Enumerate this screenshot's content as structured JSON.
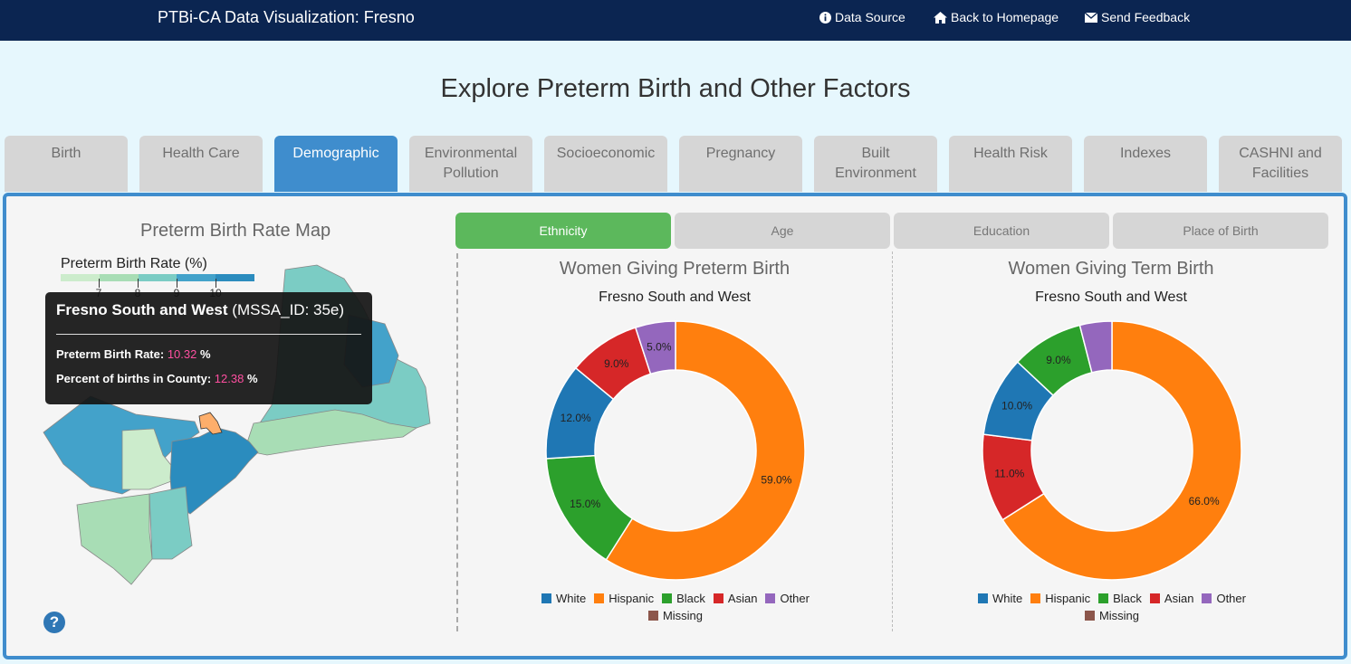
{
  "header": {
    "title": "PTBi-CA Data Visualization: Fresno",
    "links": [
      "Data Source",
      "Back to Homepage",
      "Send Feedback"
    ]
  },
  "page_title": "Explore Preterm Birth and Other Factors",
  "tabs": [
    {
      "line1": "Birth",
      "line2": ""
    },
    {
      "line1": "Health Care",
      "line2": ""
    },
    {
      "line1": "Demographic",
      "line2": ""
    },
    {
      "line1": "Environmental",
      "line2": "Pollution"
    },
    {
      "line1": "Socioeconomic",
      "line2": ""
    },
    {
      "line1": "Pregnancy",
      "line2": ""
    },
    {
      "line1": "Built",
      "line2": "Environment"
    },
    {
      "line1": "Health Risk",
      "line2": ""
    },
    {
      "line1": "Indexes",
      "line2": ""
    },
    {
      "line1": "CASHNI and",
      "line2": "Facilities"
    }
  ],
  "active_tab": "Demographic",
  "map": {
    "title": "Preterm Birth Rate Map",
    "legend_title": "Preterm Birth Rate (%)",
    "legend_ticks": [
      "7",
      "8",
      "9",
      "10"
    ],
    "legend_colors": [
      "#cceccc",
      "#a8ddb5",
      "#7bccc4",
      "#43a2ca",
      "#2b8cbe"
    ],
    "tooltip": {
      "name": "Fresno South and West",
      "id": "(MSSA_ID: 35e)",
      "rate_label": "Preterm Birth Rate:",
      "rate_value": "10.32",
      "rate_unit": "%",
      "pct_label": "Percent of births in County:",
      "pct_value": "12.38",
      "pct_unit": "%"
    },
    "help_icon": "?"
  },
  "subtabs": [
    "Ethnicity",
    "Age",
    "Education",
    "Place of Birth"
  ],
  "active_subtab": "Ethnicity",
  "charts": [
    {
      "title": "Women Giving Preterm Birth",
      "subtitle": "Fresno South and West"
    },
    {
      "title": "Women Giving Term Birth",
      "subtitle": "Fresno South and West"
    }
  ],
  "legend_items": [
    "White",
    "Hispanic",
    "Black",
    "Asian",
    "Other",
    "Missing"
  ],
  "colors": {
    "White": "#1f77b4",
    "Hispanic": "#ff7f0e",
    "Black": "#2ca02c",
    "Asian": "#d62728",
    "Other": "#9467bd",
    "Missing": "#8c564b",
    "accent": "#3f8dcd",
    "header_bg": "#0b2551"
  },
  "chart_data": [
    {
      "type": "pie",
      "title": "Women Giving Preterm Birth",
      "subtitle": "Fresno South and West",
      "slices": [
        {
          "label": "Hispanic",
          "value": 59.0,
          "text": "59.0%"
        },
        {
          "label": "Black",
          "value": 15.0,
          "text": "15.0%"
        },
        {
          "label": "White",
          "value": 12.0,
          "text": "12.0%"
        },
        {
          "label": "Asian",
          "value": 9.0,
          "text": "9.0%"
        },
        {
          "label": "Other",
          "value": 5.0,
          "text": "5.0%"
        }
      ]
    },
    {
      "type": "pie",
      "title": "Women Giving Term Birth",
      "subtitle": "Fresno South and West",
      "slices": [
        {
          "label": "Hispanic",
          "value": 66.0,
          "text": "66.0%"
        },
        {
          "label": "Asian",
          "value": 11.0,
          "text": "11.0%"
        },
        {
          "label": "White",
          "value": 10.0,
          "text": "10.0%"
        },
        {
          "label": "Black",
          "value": 9.0,
          "text": "9.0%"
        },
        {
          "label": "Other",
          "value": 4.0,
          "text": ""
        }
      ]
    }
  ]
}
